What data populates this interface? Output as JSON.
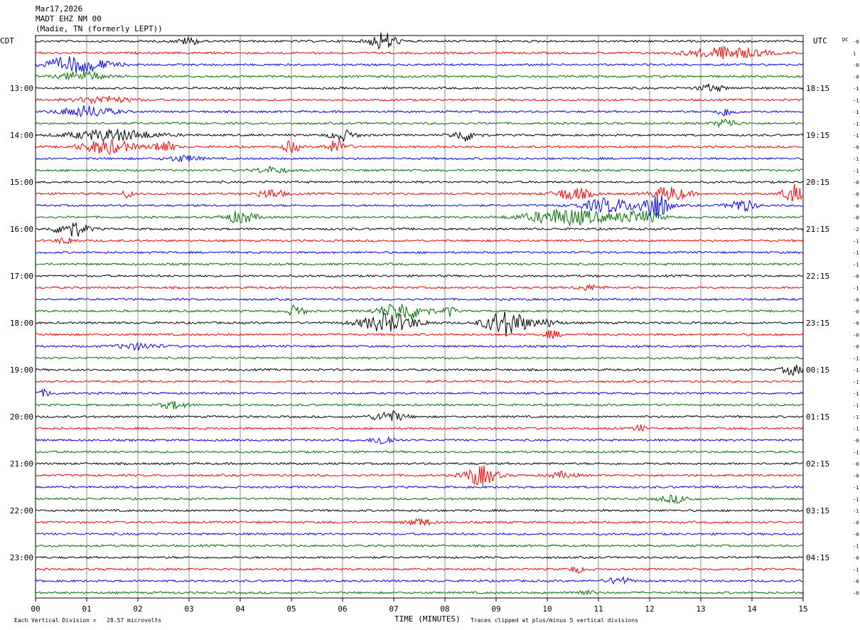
{
  "header": {
    "line1": "Mar17,2026",
    "line2": "MADT EHZ NM 00",
    "line3": "(Madie, TN (formerly LEPT))"
  },
  "chart_data": {
    "type": "line",
    "subtype": "helicorder",
    "left_timezone": "CDT",
    "right_timezone": "UTC",
    "dc_label": "DC",
    "xlabel": "TIME (MINUTES)",
    "x_ticks": [
      "00",
      "01",
      "02",
      "03",
      "04",
      "05",
      "06",
      "07",
      "08",
      "09",
      "10",
      "11",
      "12",
      "13",
      "14",
      "15"
    ],
    "xlim": [
      0,
      15
    ],
    "minutes_per_line": 15,
    "num_lines": 48,
    "trace_colors": [
      "#000000",
      "#ff0000",
      "#0000ff",
      "#007000"
    ],
    "left_hour_labels": [
      {
        "line": 4,
        "label": "13:00"
      },
      {
        "line": 8,
        "label": "14:00"
      },
      {
        "line": 12,
        "label": "15:00"
      },
      {
        "line": 16,
        "label": "16:00"
      },
      {
        "line": 20,
        "label": "17:00"
      },
      {
        "line": 24,
        "label": "18:00"
      },
      {
        "line": 28,
        "label": "19:00"
      },
      {
        "line": 32,
        "label": "20:00"
      },
      {
        "line": 36,
        "label": "21:00"
      },
      {
        "line": 40,
        "label": "22:00"
      },
      {
        "line": 44,
        "label": "23:00"
      }
    ],
    "right_hour_labels": [
      {
        "line": 4,
        "label": "18:15"
      },
      {
        "line": 8,
        "label": "19:15"
      },
      {
        "line": 12,
        "label": "20:15"
      },
      {
        "line": 16,
        "label": "21:15"
      },
      {
        "line": 20,
        "label": "22:15"
      },
      {
        "line": 24,
        "label": "23:15"
      },
      {
        "line": 28,
        "label": "00:15"
      },
      {
        "line": 32,
        "label": "01:15"
      },
      {
        "line": 36,
        "label": "02:15"
      },
      {
        "line": 40,
        "label": "03:15"
      },
      {
        "line": 44,
        "label": "04:15"
      }
    ],
    "dc_offsets": [
      "-0",
      "1",
      "-0",
      "-0",
      "-1",
      "-1",
      "-1",
      "-1",
      "-1",
      "-0",
      "-1",
      "-1",
      "-0",
      "-0",
      "-0",
      "-0",
      "-2",
      "-1",
      "-1",
      "-1",
      "-0",
      "-1",
      "-0",
      "-0",
      "-0",
      "-0",
      "-0",
      "-1",
      "-1",
      "-1",
      "-1",
      "-1",
      "-1",
      "-1",
      "-0",
      "-1",
      "-0",
      "-0",
      "-1",
      "-1",
      "-1",
      "-0",
      "-0",
      "-1",
      "-0",
      "-1",
      "-0",
      "-0"
    ],
    "events": [
      {
        "line": 0,
        "minute": 6.8,
        "amp": 0.9,
        "dur": 0.5
      },
      {
        "line": 0,
        "minute": 3.0,
        "amp": 0.35,
        "dur": 0.4
      },
      {
        "line": 1,
        "minute": 13.5,
        "amp": 0.6,
        "dur": 1.4
      },
      {
        "line": 2,
        "minute": 0.8,
        "amp": 0.8,
        "dur": 1.2
      },
      {
        "line": 3,
        "minute": 0.9,
        "amp": 0.5,
        "dur": 0.8
      },
      {
        "line": 4,
        "minute": 13.2,
        "amp": 0.35,
        "dur": 0.5
      },
      {
        "line": 5,
        "minute": 1.3,
        "amp": 0.35,
        "dur": 1.0
      },
      {
        "line": 6,
        "minute": 1.0,
        "amp": 0.55,
        "dur": 1.0
      },
      {
        "line": 6,
        "minute": 13.5,
        "amp": 0.4,
        "dur": 0.4
      },
      {
        "line": 7,
        "minute": 13.5,
        "amp": 0.45,
        "dur": 0.4
      },
      {
        "line": 8,
        "minute": 1.5,
        "amp": 0.55,
        "dur": 1.6
      },
      {
        "line": 8,
        "minute": 6.0,
        "amp": 0.5,
        "dur": 0.5
      },
      {
        "line": 8,
        "minute": 8.4,
        "amp": 0.55,
        "dur": 0.5
      },
      {
        "line": 9,
        "minute": 1.4,
        "amp": 0.7,
        "dur": 1.0
      },
      {
        "line": 9,
        "minute": 2.5,
        "amp": 0.6,
        "dur": 0.4
      },
      {
        "line": 9,
        "minute": 5.0,
        "amp": 0.6,
        "dur": 0.3
      },
      {
        "line": 9,
        "minute": 5.9,
        "amp": 0.7,
        "dur": 0.4
      },
      {
        "line": 10,
        "minute": 2.9,
        "amp": 0.3,
        "dur": 0.6
      },
      {
        "line": 11,
        "minute": 4.6,
        "amp": 0.3,
        "dur": 0.6
      },
      {
        "line": 13,
        "minute": 1.8,
        "amp": 0.4,
        "dur": 0.2
      },
      {
        "line": 13,
        "minute": 4.6,
        "amp": 0.45,
        "dur": 0.5
      },
      {
        "line": 13,
        "minute": 10.5,
        "amp": 0.6,
        "dur": 0.7
      },
      {
        "line": 13,
        "minute": 12.4,
        "amp": 0.7,
        "dur": 0.7
      },
      {
        "line": 13,
        "minute": 14.8,
        "amp": 0.9,
        "dur": 0.4
      },
      {
        "line": 14,
        "minute": 11.2,
        "amp": 0.7,
        "dur": 1.0
      },
      {
        "line": 14,
        "minute": 12.1,
        "amp": 1.5,
        "dur": 0.5
      },
      {
        "line": 14,
        "minute": 13.8,
        "amp": 0.6,
        "dur": 0.5
      },
      {
        "line": 15,
        "minute": 4.0,
        "amp": 0.6,
        "dur": 0.6
      },
      {
        "line": 15,
        "minute": 10.4,
        "amp": 0.8,
        "dur": 1.6
      },
      {
        "line": 15,
        "minute": 11.8,
        "amp": 0.6,
        "dur": 0.8
      },
      {
        "line": 16,
        "minute": 0.7,
        "amp": 0.8,
        "dur": 0.6
      },
      {
        "line": 17,
        "minute": 0.6,
        "amp": 0.3,
        "dur": 0.4
      },
      {
        "line": 21,
        "minute": 10.8,
        "amp": 0.25,
        "dur": 0.5
      },
      {
        "line": 23,
        "minute": 5.1,
        "amp": 0.6,
        "dur": 0.3
      },
      {
        "line": 23,
        "minute": 7.2,
        "amp": 0.9,
        "dur": 0.9
      },
      {
        "line": 23,
        "minute": 8.1,
        "amp": 0.55,
        "dur": 0.2
      },
      {
        "line": 24,
        "minute": 6.9,
        "amp": 0.9,
        "dur": 1.1
      },
      {
        "line": 24,
        "minute": 9.2,
        "amp": 1.3,
        "dur": 0.8
      },
      {
        "line": 24,
        "minute": 10.0,
        "amp": 0.3,
        "dur": 0.5
      },
      {
        "line": 25,
        "minute": 10.1,
        "amp": 0.4,
        "dur": 0.3
      },
      {
        "line": 26,
        "minute": 2.0,
        "amp": 0.3,
        "dur": 0.8
      },
      {
        "line": 28,
        "minute": 14.8,
        "amp": 0.5,
        "dur": 0.4
      },
      {
        "line": 30,
        "minute": 0.2,
        "amp": 0.3,
        "dur": 0.3
      },
      {
        "line": 31,
        "minute": 2.7,
        "amp": 0.35,
        "dur": 0.5
      },
      {
        "line": 32,
        "minute": 6.9,
        "amp": 0.55,
        "dur": 0.6
      },
      {
        "line": 33,
        "minute": 11.8,
        "amp": 0.35,
        "dur": 0.2
      },
      {
        "line": 34,
        "minute": 6.8,
        "amp": 0.5,
        "dur": 0.4
      },
      {
        "line": 37,
        "minute": 8.7,
        "amp": 1.0,
        "dur": 0.6
      },
      {
        "line": 37,
        "minute": 10.3,
        "amp": 0.3,
        "dur": 0.5
      },
      {
        "line": 39,
        "minute": 12.5,
        "amp": 0.35,
        "dur": 0.6
      },
      {
        "line": 41,
        "minute": 7.5,
        "amp": 0.35,
        "dur": 0.5
      },
      {
        "line": 45,
        "minute": 10.6,
        "amp": 0.3,
        "dur": 0.3
      },
      {
        "line": 46,
        "minute": 11.4,
        "amp": 0.4,
        "dur": 0.4
      },
      {
        "line": 47,
        "minute": 10.7,
        "amp": 0.2,
        "dur": 0.5
      }
    ]
  },
  "footer": {
    "scale_note": "Each Vertical Division =   28.57 microvolts",
    "clip_note": "Traces clipped at plus/minus 5 vertical divisions"
  }
}
